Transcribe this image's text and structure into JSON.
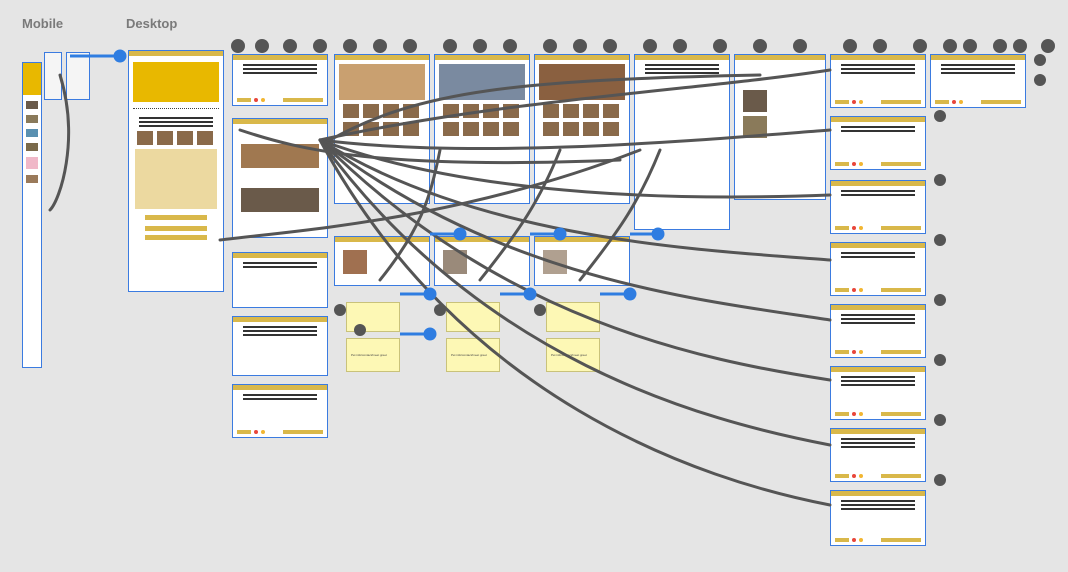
{
  "labels": {
    "mobile": "Mobile",
    "desktop": "Desktop"
  },
  "notes": [
    "Pet info/contact/meet greet",
    "Pet info/contact/meet greet",
    "Pet info/contact/meet greet"
  ],
  "colors": {
    "wire": "#555555",
    "wire_active": "#2f7de1",
    "frame_border": "#3b7be0",
    "accent": "#d9b84a",
    "background": "#e5e5e5"
  }
}
